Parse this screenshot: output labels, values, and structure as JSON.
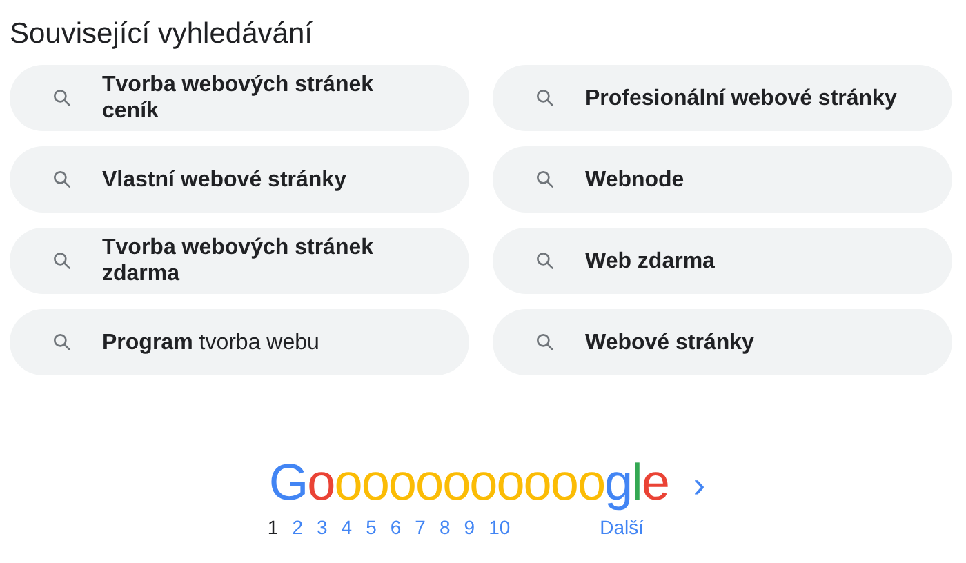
{
  "heading": "Související vyhledávání",
  "searches": [
    {
      "text": "Tvorba webových stránek ceník",
      "bold": true
    },
    {
      "text": "Profesionální webové stránky",
      "bold": true
    },
    {
      "text": "Vlastní webové stránky",
      "bold": true
    },
    {
      "text": "Webnode",
      "bold": true
    },
    {
      "text": "Tvorba webových stránek zdarma",
      "bold": true
    },
    {
      "text": "Web zdarma",
      "bold": true
    },
    {
      "text": "**Program** tvorba webu",
      "bold": false
    },
    {
      "text": "Webové stránky",
      "bold": true
    }
  ],
  "pager": {
    "logo": [
      {
        "letter": "G",
        "color": "#4285f4"
      },
      {
        "letter": "o",
        "color": "#ea4335"
      },
      {
        "letter": "o",
        "color": "#fbbc05"
      },
      {
        "letter": "o",
        "color": "#fbbc05"
      },
      {
        "letter": "o",
        "color": "#fbbc05"
      },
      {
        "letter": "o",
        "color": "#fbbc05"
      },
      {
        "letter": "o",
        "color": "#fbbc05"
      },
      {
        "letter": "o",
        "color": "#fbbc05"
      },
      {
        "letter": "o",
        "color": "#fbbc05"
      },
      {
        "letter": "o",
        "color": "#fbbc05"
      },
      {
        "letter": "o",
        "color": "#fbbc05"
      },
      {
        "letter": "o",
        "color": "#fbbc05"
      },
      {
        "letter": "g",
        "color": "#4285f4"
      },
      {
        "letter": "l",
        "color": "#34a853"
      },
      {
        "letter": "e",
        "color": "#ea4335"
      }
    ],
    "next_arrow": "›",
    "pages": [
      {
        "label": "1",
        "selected": true
      },
      {
        "label": "2",
        "selected": false
      },
      {
        "label": "3",
        "selected": false
      },
      {
        "label": "4",
        "selected": false
      },
      {
        "label": "5",
        "selected": false
      },
      {
        "label": "6",
        "selected": false
      },
      {
        "label": "7",
        "selected": false
      },
      {
        "label": "8",
        "selected": false
      },
      {
        "label": "9",
        "selected": false
      },
      {
        "label": "10",
        "selected": false
      }
    ],
    "next_label": "Další"
  }
}
